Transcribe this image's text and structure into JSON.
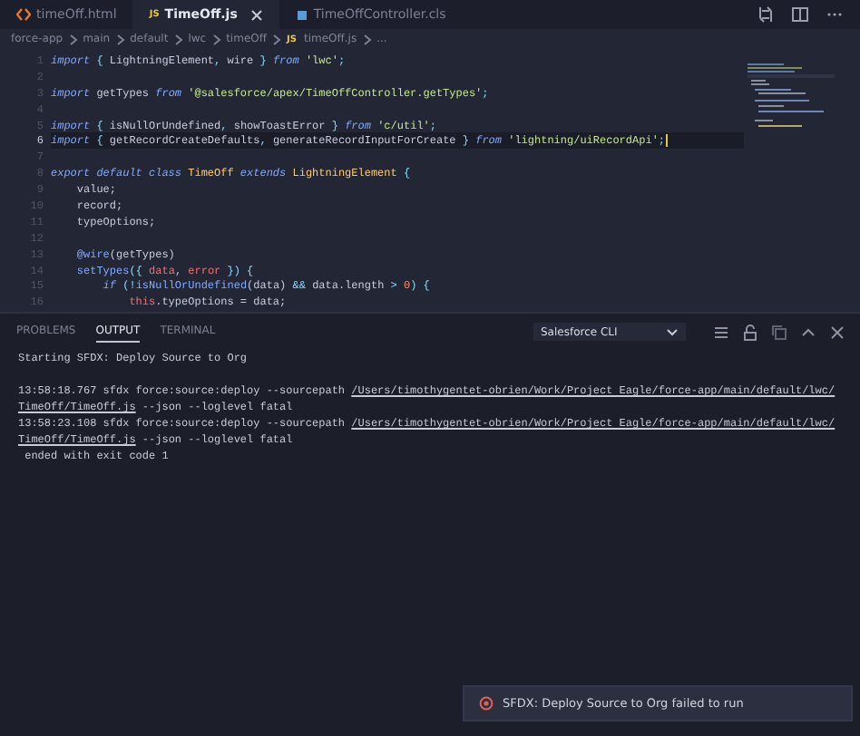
{
  "tabs": [
    {
      "label": "timeOff.html",
      "kind": "html",
      "selected": false
    },
    {
      "label": "TimeOff.js",
      "kind": "js",
      "badge": "JS",
      "selected": true
    },
    {
      "label": "TimeOffController.cls",
      "kind": "cls",
      "selected": false
    }
  ],
  "breadcrumb": [
    {
      "label": "force-app"
    },
    {
      "label": "main"
    },
    {
      "label": "default"
    },
    {
      "label": "lwc"
    },
    {
      "label": "timeOff"
    },
    {
      "label": "timeOff.js",
      "badge": "JS"
    },
    {
      "label": "..."
    }
  ],
  "code": [
    {
      "number": "1",
      "current": false,
      "tokens": [
        {
          "text": "import",
          "kind": "keyword"
        },
        {
          "text": " { ",
          "kind": "punct"
        },
        {
          "text": "LightningElement",
          "kind": "plain"
        },
        {
          "text": ", ",
          "kind": "punct"
        },
        {
          "text": "wire",
          "kind": "plain"
        },
        {
          "text": " } ",
          "kind": "punct"
        },
        {
          "text": "from",
          "kind": "keyword"
        },
        {
          "text": " 'lwc'",
          "kind": "string"
        },
        {
          "text": ";",
          "kind": "punct"
        }
      ]
    },
    {
      "number": "2",
      "current": false
    },
    {
      "number": "3",
      "current": false,
      "tokens": [
        {
          "text": "import",
          "kind": "keyword"
        },
        {
          "text": " getTypes ",
          "kind": "plain"
        },
        {
          "text": "from",
          "kind": "keyword"
        },
        {
          "text": " '@salesforce/apex/TimeOffController.getTypes'",
          "kind": "string"
        },
        {
          "text": ";",
          "kind": "punct"
        }
      ]
    },
    {
      "number": "4",
      "current": false
    },
    {
      "number": "5",
      "current": false,
      "tokens": [
        {
          "text": "import",
          "kind": "keyword"
        },
        {
          "text": " { ",
          "kind": "punct"
        },
        {
          "text": "isNullOrUndefined",
          "kind": "plain"
        },
        {
          "text": ", ",
          "kind": "punct"
        },
        {
          "text": "showToastError",
          "kind": "plain"
        },
        {
          "text": " } ",
          "kind": "punct"
        },
        {
          "text": "from",
          "kind": "keyword"
        },
        {
          "text": " 'c/util'",
          "kind": "string"
        },
        {
          "text": ";",
          "kind": "punct"
        }
      ]
    },
    {
      "number": "6",
      "current": true,
      "tokens": [
        {
          "text": "import",
          "kind": "keyword"
        },
        {
          "text": " { ",
          "kind": "punct"
        },
        {
          "text": "getRecordCreateDefaults",
          "kind": "plain"
        },
        {
          "text": ", ",
          "kind": "punct"
        },
        {
          "text": "generateRecordInputForCreate",
          "kind": "plain"
        },
        {
          "text": " } ",
          "kind": "punct"
        },
        {
          "text": "from",
          "kind": "keyword"
        },
        {
          "text": " 'lightning/uiRecordApi'",
          "kind": "string"
        },
        {
          "text": ";",
          "kind": "punct"
        }
      ]
    },
    {
      "number": "7",
      "current": false
    },
    {
      "number": "8",
      "current": false,
      "tokens": [
        {
          "text": "export default class",
          "kind": "keyword"
        },
        {
          "text": " TimeOff ",
          "kind": "class"
        },
        {
          "text": "extends",
          "kind": "keyword"
        },
        {
          "text": " LightningElement",
          "kind": "class"
        },
        {
          "text": " {",
          "kind": "punct"
        }
      ]
    },
    {
      "number": "9",
      "current": false,
      "tokens": [
        {
          "text": "    value;",
          "kind": "plain"
        }
      ]
    },
    {
      "number": "10",
      "current": false,
      "tokens": [
        {
          "text": "    record;",
          "kind": "plain"
        }
      ]
    },
    {
      "number": "11",
      "current": false,
      "tokens": [
        {
          "text": "    typeOptions;",
          "kind": "plain"
        }
      ]
    },
    {
      "number": "12",
      "current": false
    },
    {
      "number": "13",
      "current": false,
      "tokens": [
        {
          "text": "    @wire",
          "kind": "function"
        },
        {
          "text": "(getTypes)",
          "kind": "plain"
        }
      ]
    },
    {
      "number": "14",
      "current": false,
      "tokens": [
        {
          "text": "    setTypes",
          "kind": "function"
        },
        {
          "text": "({ ",
          "kind": "punct"
        },
        {
          "text": "data",
          "kind": "param"
        },
        {
          "text": ", ",
          "kind": "punct"
        },
        {
          "text": "error",
          "kind": "param"
        },
        {
          "text": " }) {",
          "kind": "punct"
        }
      ]
    },
    {
      "number": "15",
      "current": false,
      "tokens": [
        {
          "text": "        if",
          "kind": "keyword"
        },
        {
          "text": " (!",
          "kind": "punct"
        },
        {
          "text": "isNullOrUndefined",
          "kind": "function"
        },
        {
          "text": "(data) ",
          "kind": "plain"
        },
        {
          "text": "&&",
          "kind": "punct"
        },
        {
          "text": " data.length ",
          "kind": "plain"
        },
        {
          "text": ">",
          "kind": "punct"
        },
        {
          "text": " 0",
          "kind": "number"
        },
        {
          "text": ") {",
          "kind": "punct"
        }
      ]
    },
    {
      "number": "16",
      "current": false,
      "tokens": [
        {
          "text": "            this",
          "kind": "param"
        },
        {
          "text": ".typeOptions = data;",
          "kind": "plain"
        }
      ]
    }
  ],
  "panel": {
    "tabs": [
      {
        "label": "PROBLEMS",
        "selected": false
      },
      {
        "label": "OUTPUT",
        "selected": true
      },
      {
        "label": "TERMINAL",
        "selected": false
      }
    ],
    "channel": "Salesforce CLI",
    "output": [
      {
        "lines": [
          [
            {
              "text": "Starting SFDX: Deploy Source to Org",
              "link": false
            }
          ]
        ]
      },
      {
        "lines": [
          [
            {
              "text": "13:58:18.767 sfdx force:source:deploy --sourcepath ",
              "link": false
            },
            {
              "text": "/Users/timothygentet-obrien/Work/Project Eagle/force-app/main/default/lwc/",
              "link": true
            }
          ],
          [
            {
              "text": "TimeOff/TimeOff.js",
              "link": true
            },
            {
              "text": " --json --loglevel fatal",
              "link": false
            }
          ],
          [
            {
              "text": "13:58:23.108 sfdx force:source:deploy --sourcepath ",
              "link": false
            },
            {
              "text": "/Users/timothygentet-obrien/Work/Project Eagle/force-app/main/default/lwc/",
              "link": true
            }
          ],
          [
            {
              "text": "TimeOff/TimeOff.js",
              "link": true
            },
            {
              "text": " --json --loglevel fatal",
              "link": false
            }
          ],
          [
            {
              "text": " ended with exit code 1",
              "link": false
            }
          ]
        ]
      }
    ]
  },
  "toast": {
    "kind": "error",
    "message": "SFDX: Deploy Source to Org failed to run"
  }
}
